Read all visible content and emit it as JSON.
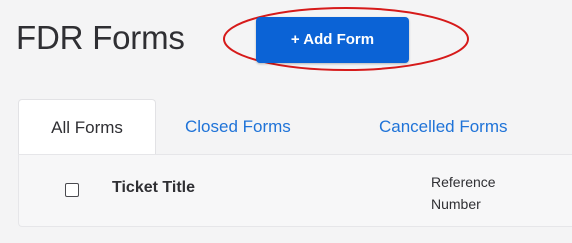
{
  "header": {
    "title": "FDR Forms",
    "add_button_label": "+ Add Form"
  },
  "tabs": [
    {
      "label": "All Forms",
      "active": true
    },
    {
      "label": "Closed Forms",
      "active": false
    },
    {
      "label": "Cancelled Forms",
      "active": false
    }
  ],
  "table": {
    "columns": [
      {
        "label": "Ticket Title"
      },
      {
        "label": "Reference Number"
      }
    ]
  },
  "colors": {
    "accent": "#0b63d6",
    "link": "#1f73d8",
    "annotation": "#d61a1a"
  },
  "icons": {
    "select_all": "checkbox-unchecked-icon"
  }
}
